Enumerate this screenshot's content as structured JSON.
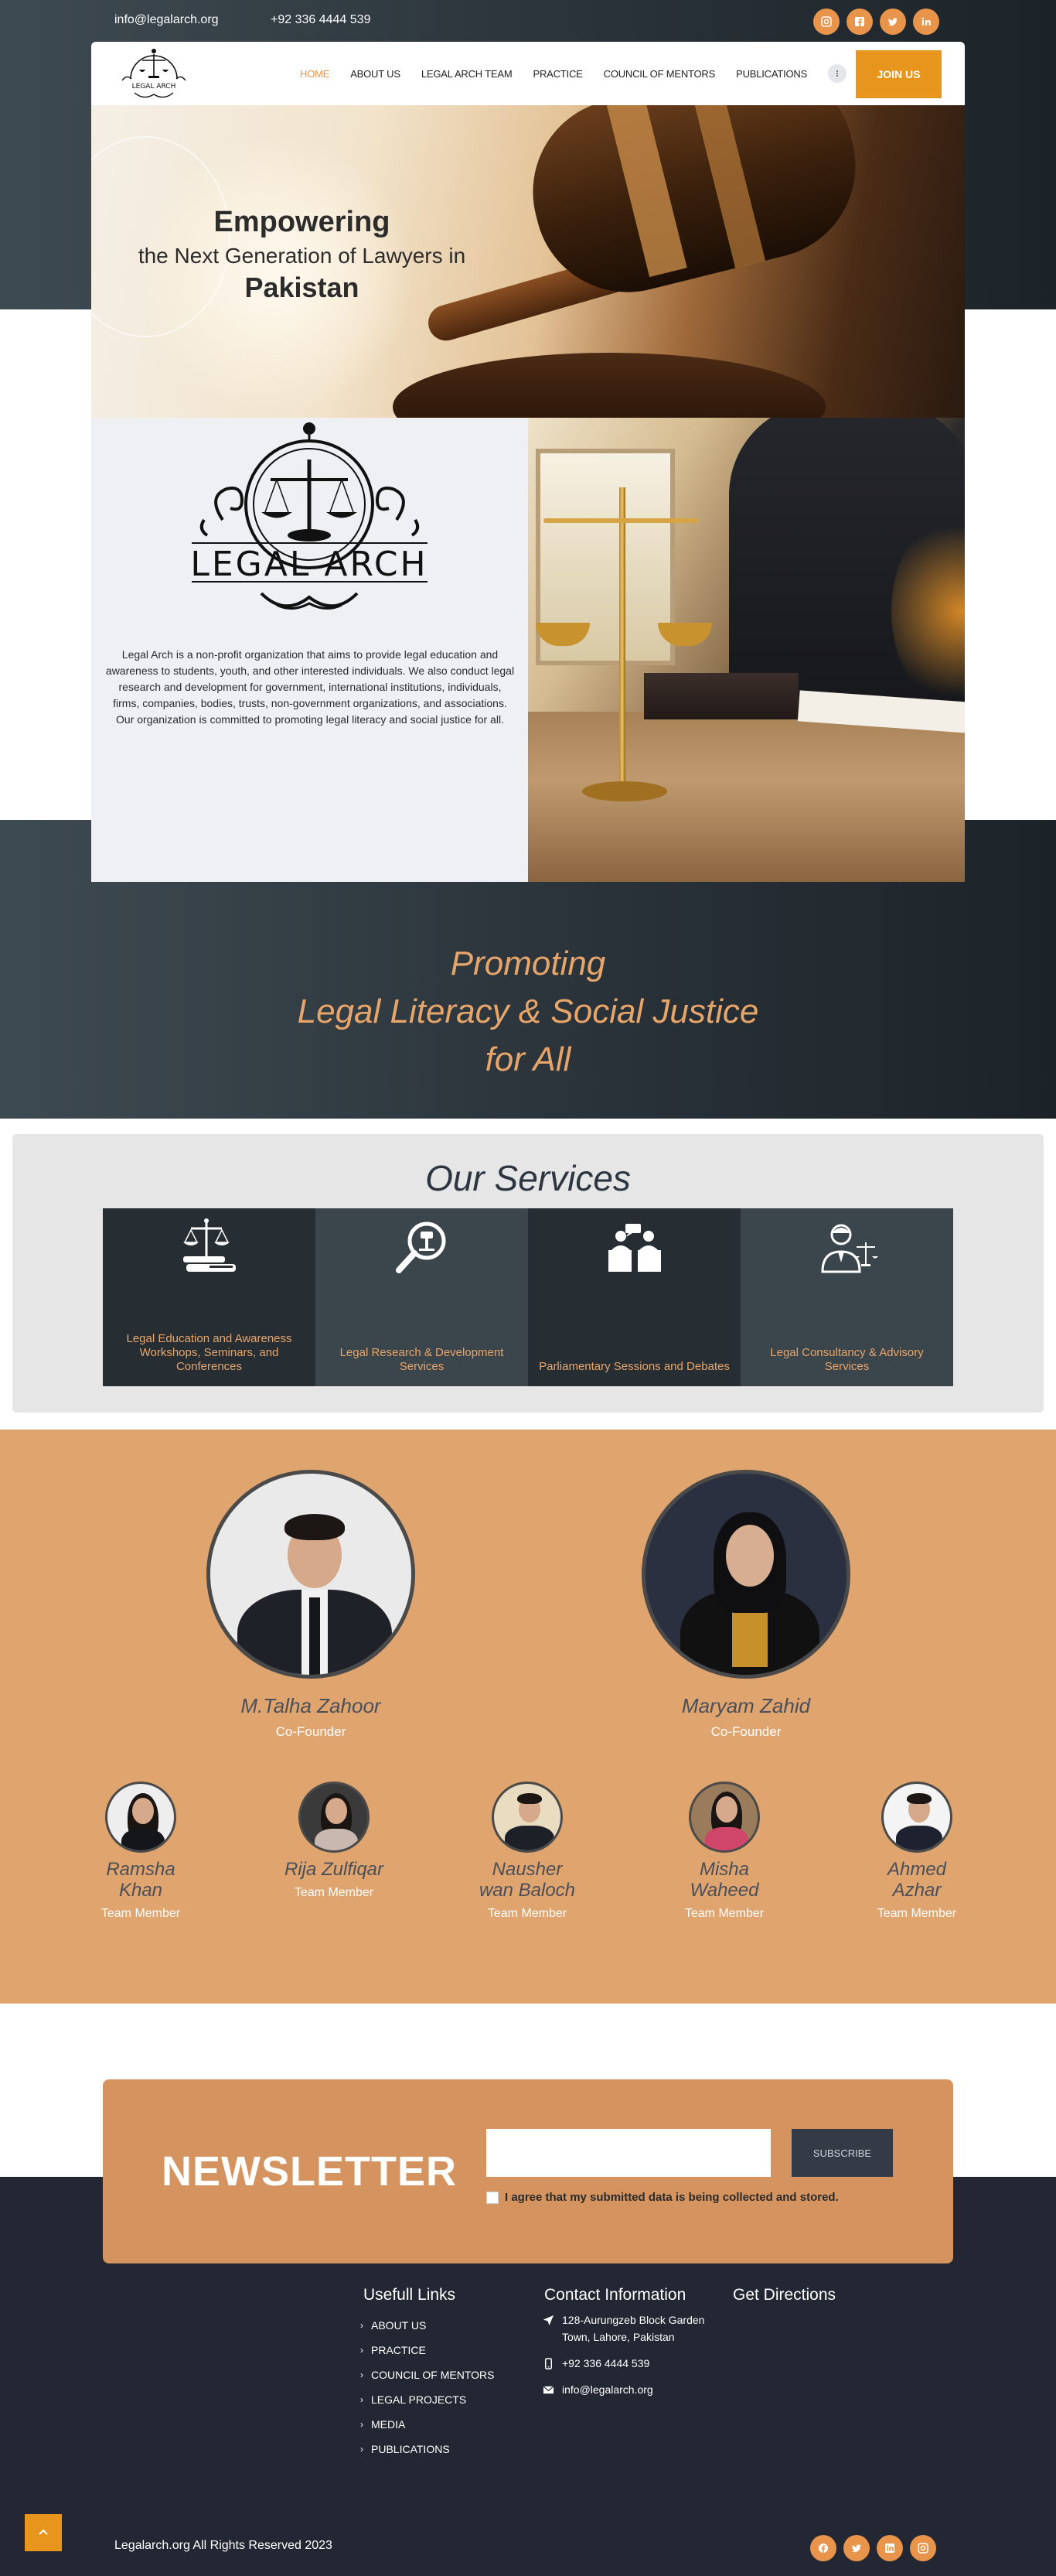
{
  "topbar": {
    "email": "info@legalarch.org",
    "phone": "+92 336 4444 539",
    "social": [
      "instagram-icon",
      "facebook-icon",
      "twitter-icon",
      "linkedin-icon"
    ]
  },
  "nav": {
    "logo_text": "LEGAL ARCH",
    "items": [
      "HOME",
      "ABOUT US",
      "LEGAL ARCH TEAM",
      "PRACTICE",
      "COUNCIL OF MENTORS",
      "PUBLICATIONS"
    ],
    "active": "HOME",
    "join_label": "JOIN US"
  },
  "hero": {
    "line1": "Empowering",
    "line2": "the Next Generation of Lawyers in",
    "line3": "Pakistan"
  },
  "about": {
    "logo_text": "LEGAL ARCH",
    "text": "Legal Arch is a non-profit organization that aims to provide legal education and awareness to students, youth, and other interested individuals. We also conduct legal research and development for government, international institutions, individuals, firms, companies, bodies, trusts, non-government organizations, and associations. Our organization is committed to promoting legal literacy and social justice for all."
  },
  "promo": {
    "line1": "Promoting",
    "line2": "Legal Literacy & Social Justice",
    "line3": "for All"
  },
  "services": {
    "title": "Our Services",
    "items": [
      {
        "label": "Legal Education and Awareness Workshops, Seminars, and Conferences",
        "icon": "scales-book-icon"
      },
      {
        "label": "Legal Research & Development Services",
        "icon": "magnifier-icon"
      },
      {
        "label": "Parliamentary Sessions and Debates",
        "icon": "debate-podium-icon"
      },
      {
        "label": "Legal Consultancy & Advisory Services",
        "icon": "lawyer-consultant-icon"
      }
    ]
  },
  "team": {
    "founders": [
      {
        "name": "M.Talha Zahoor",
        "role": "Co-Founder"
      },
      {
        "name": "Maryam Zahid",
        "role": "Co-Founder"
      }
    ],
    "members": [
      {
        "name": "Ramsha Khan",
        "role": "Team Member"
      },
      {
        "name": "Rija Zulfiqar",
        "role": "Team Member"
      },
      {
        "name": "Nausher wan Baloch",
        "role": "Team Member"
      },
      {
        "name": "Misha Waheed",
        "role": "Team Member"
      },
      {
        "name": "Ahmed Azhar",
        "role": "Team Member"
      }
    ]
  },
  "newsletter": {
    "title": "NEWSLETTER",
    "input_value": "",
    "subscribe_label": "SUBSCRIBE",
    "agree_text": "I agree that my submitted data is being collected and stored."
  },
  "footer": {
    "links_title": "Usefull Links",
    "links": [
      "ABOUT US",
      "PRACTICE",
      "COUNCIL OF MENTORS",
      "LEGAL PROJECTS",
      "MEDIA",
      "PUBLICATIONS"
    ],
    "contact_title": "Contact Information",
    "address": "128-Aurungzeb Block Garden Town, Lahore, Pakistan",
    "phone": "+92 336 4444 539",
    "email": "info@legalarch.org",
    "directions_title": "Get Directions",
    "copyright": "Legalarch.org All Rights Reserved 2023",
    "social": [
      "facebook-icon",
      "twitter-icon",
      "linkedin-icon",
      "instagram-icon"
    ]
  },
  "colors": {
    "accent": "#e8951d",
    "accent_soft": "#e0a46e",
    "dark": "#232733",
    "promo_text": "#e8a56a"
  }
}
